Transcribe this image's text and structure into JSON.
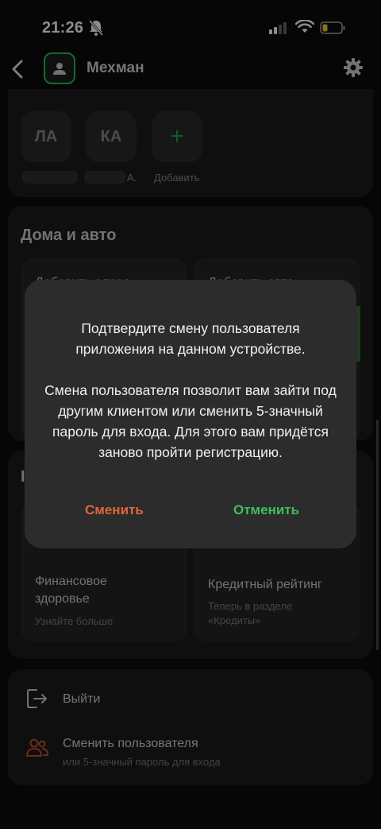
{
  "status_bar": {
    "time": "21:26"
  },
  "header": {
    "title": "Мехман"
  },
  "people": {
    "chips": [
      {
        "initials": "ЛА"
      },
      {
        "initials": "КА"
      },
      {
        "initials": "+"
      }
    ],
    "labels": [
      "А.",
      "Добавить"
    ]
  },
  "homes": {
    "title": "Дома и авто",
    "add_address": "Добавить адрес",
    "add_auto": "Добавить авто"
  },
  "services": {
    "financial": {
      "title": "Финансовое здоровье",
      "subtitle": "Узнайте больше"
    },
    "credit": {
      "title": "Кредитный рейтинг",
      "subtitle": "Теперь в разделе «Кредиты»"
    }
  },
  "actions": {
    "logout": "Выйти",
    "switch_user": "Сменить пользователя",
    "switch_user_sub": "или 5-значный пароль для входа"
  },
  "dialog": {
    "line1": "Подтвердите смену пользователя приложения на данном устройстве.",
    "line2": "Смена пользователя позволит вам зайти под другим клиентом или сменить 5-значный пароль для входа. Для этого вам придётся заново пройти регистрацию.",
    "confirm": "Сменить",
    "cancel": "Отменить"
  },
  "colors": {
    "accent_green": "#22c15a",
    "warning_orange": "#e0663a",
    "card_bg": "#1c1c1c"
  }
}
